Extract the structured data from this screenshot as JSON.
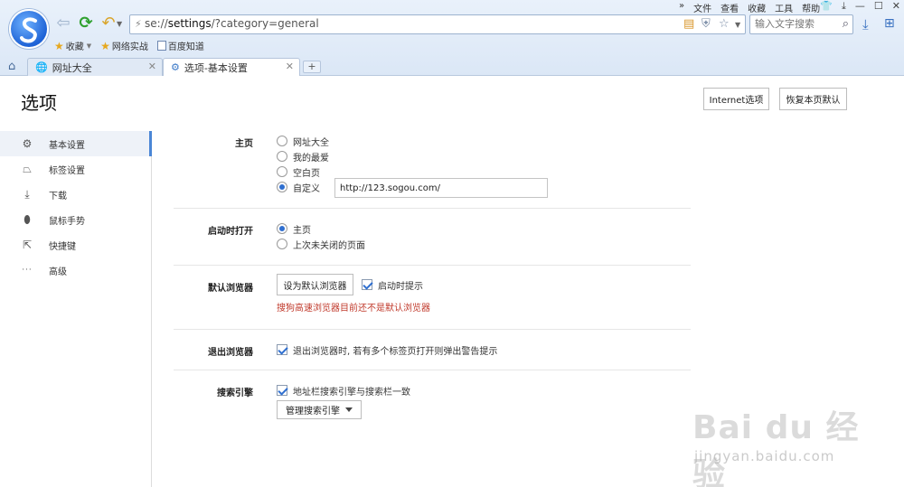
{
  "browser": {
    "menu": [
      "文件",
      "查看",
      "收藏",
      "工具",
      "帮助"
    ],
    "address": {
      "prefix": "se://",
      "host": "settings",
      "path": "/?category=general"
    },
    "search_placeholder": "输入文字搜索",
    "bookmarks": [
      "收藏",
      "网络实战",
      "百度知道"
    ],
    "tabs": [
      {
        "label": "网址大全",
        "active": false
      },
      {
        "label": "选项-基本设置",
        "active": true
      }
    ],
    "new_tab": "+"
  },
  "page": {
    "title": "选项",
    "header_buttons": {
      "ie_options": "Internet选项",
      "restore": "恢复本页默认"
    }
  },
  "sidebar": {
    "items": [
      {
        "label": "基本设置",
        "icon": "gear-icon",
        "glyph": "⚙",
        "active": true
      },
      {
        "label": "标签设置",
        "icon": "tab-icon",
        "glyph": "⏢",
        "active": false
      },
      {
        "label": "下载",
        "icon": "download-icon",
        "glyph": "⤓",
        "active": false
      },
      {
        "label": "鼠标手势",
        "icon": "mouse-icon",
        "glyph": "⬮",
        "active": false
      },
      {
        "label": "快捷键",
        "icon": "shortcut-icon",
        "glyph": "⇱",
        "active": false
      },
      {
        "label": "高级",
        "icon": "more-icon",
        "glyph": "···",
        "active": false
      }
    ]
  },
  "settings": {
    "homepage": {
      "label": "主页",
      "options": [
        "网址大全",
        "我的最爱",
        "空白页",
        "自定义"
      ],
      "selected": 3,
      "custom_url": "http://123.sogou.com/"
    },
    "startup": {
      "label": "启动时打开",
      "options": [
        "主页",
        "上次未关闭的页面"
      ],
      "selected": 0
    },
    "default_browser": {
      "label": "默认浏览器",
      "button": "设为默认浏览器",
      "check_label": "启动时提示",
      "checked": true,
      "warning": "搜狗高速浏览器目前还不是默认浏览器"
    },
    "exit": {
      "label": "退出浏览器",
      "check_label": "退出浏览器时, 若有多个标签页打开则弹出警告提示",
      "checked": true
    },
    "search_engine": {
      "label": "搜索引擎",
      "check_label": "地址栏搜索引擎与搜索栏一致",
      "checked": true,
      "manage_button": "管理搜索引擎"
    }
  },
  "watermark": {
    "text": "Bai du 经验",
    "url": "jingyan.baidu.com"
  },
  "colors": {
    "accent": "#2f6fd0",
    "warning": "#c0392b",
    "sidebar_active": "#eef2f8"
  }
}
